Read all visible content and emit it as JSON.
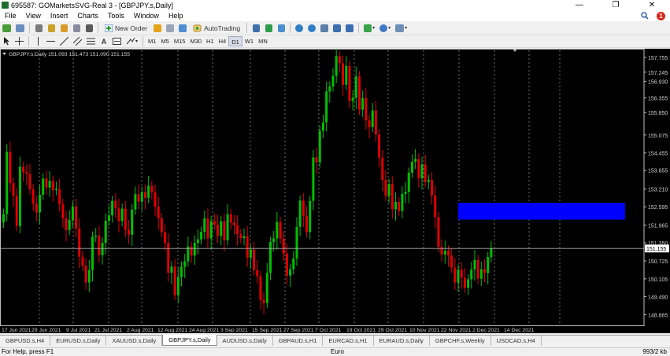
{
  "window": {
    "title": "695587: GOMarketsSVG-Real 3 - [GBPJPY.s,Daily]",
    "minimize_glyph": "—",
    "restore_glyph": "❐",
    "close_glyph": "✕"
  },
  "menu": {
    "items": [
      "File",
      "View",
      "Insert",
      "Charts",
      "Tools",
      "Window",
      "Help"
    ],
    "notification_count": "1"
  },
  "toolbar": {
    "new_order_label": "New Order",
    "autotrading_label": "AutoTrading"
  },
  "timeframes": [
    "M1",
    "M5",
    "M15",
    "M30",
    "H1",
    "H4",
    "D1",
    "W1",
    "MN"
  ],
  "active_timeframe": "D1",
  "chart": {
    "header": "GBPJPY.s,Daily  151.093 151.473 151.090 151.155",
    "current_price_label": "151.155"
  },
  "chart_data": {
    "type": "candlestick",
    "symbol": "GBPJPY.s",
    "timeframe": "Daily",
    "y_range": [
      148.5,
      158.0
    ],
    "y_ticks": [
      "157.755",
      "157.245",
      "156.930",
      "156.355",
      "155.850",
      "155.075",
      "154.455",
      "153.855",
      "153.210",
      "152.595",
      "151.965",
      "151.350",
      "150.725",
      "150.105",
      "149.490",
      "148.865"
    ],
    "x_labels": [
      "17 Jun 2021",
      "29 Jun 2021",
      "9 Jul 2021",
      "21 Jul 2021",
      "2 Aug 2021",
      "12 Aug 2021",
      "24 Aug 2021",
      "3 Sep 2021",
      "15 Sep 2021",
      "27 Sep 2021",
      "7 Oct 2021",
      "19 Oct 2021",
      "29 Oct 2021",
      "10 Nov 2021",
      "22 Nov 2021",
      "2 Dec 2021",
      "14 Dec 2021"
    ],
    "last_price": 151.155,
    "zone_rectangle": {
      "price_high": 152.73,
      "price_low": 152.15,
      "color": "#0000ff"
    },
    "up_color": "#00c000",
    "down_color": "#e00000",
    "closes": [
      152.35,
      154.5,
      153.41,
      152.98,
      151.93,
      153.98,
      153.79,
      153.73,
      153.2,
      152.7,
      152.4,
      153.01,
      153.57,
      153.26,
      153.49,
      153.17,
      153.21,
      152.68,
      152.2,
      151.79,
      152.14,
      152.61,
      151.85,
      150.87,
      150.56,
      149.98,
      150.41,
      151.56,
      151.6,
      150.92,
      151.35,
      152.11,
      152.3,
      152.8,
      152.54,
      152.1,
      152.53,
      151.8,
      151.63,
      152.5,
      153.03,
      152.77,
      153.11,
      152.9,
      153.32,
      153.1,
      152.6,
      152.2,
      151.72,
      151.34,
      150.32,
      150.53,
      149.54,
      150.17,
      150.52,
      150.71,
      151.22,
      150.91,
      151.35,
      151.47,
      151.73,
      152.2,
      151.5,
      152.1,
      151.98,
      151.59,
      152.1,
      151.44,
      152.34,
      152.05,
      151.96,
      151.65,
      151.51,
      151.58,
      150.84,
      151.12,
      150.41,
      150.2,
      149.38,
      149.27,
      150.31,
      151.38,
      151.5,
      152.07,
      151.5,
      150.98,
      150.22,
      150.44,
      150.81,
      151.9,
      152.81,
      152.28,
      151.72,
      152.8,
      154.3,
      154.13,
      155.22,
      155.51,
      156.58,
      156.75,
      157.12,
      157.8,
      157.55,
      156.81,
      157.46,
      156.25,
      156.36,
      157.1,
      155.95,
      156.35,
      155.58,
      155.35,
      155.92,
      155.09,
      154.29,
      153.52,
      152.98,
      153.38,
      152.51,
      152.76,
      152.45,
      153.04,
      153.11,
      153.77,
      154.15,
      154.25,
      153.58,
      154.05,
      153.45,
      153.52,
      152.99,
      152.24,
      151.21,
      150.95,
      151.08,
      150.91,
      150.49,
      149.98,
      150.43,
      150.14,
      149.8,
      150.09,
      150.43,
      150.76,
      150.11,
      150.44,
      150.31,
      150.86,
      151.15
    ]
  },
  "tabs": [
    "GBPUSD.s,H4",
    "EURUSD.s,Daily",
    "XAUUSD.s,Daily",
    "GBPJPY.s,Daily",
    "AUDUSD.s,Daily",
    "GBPAUD.s,H1",
    "EURCAD.s,H1",
    "EURAUD.s,Daily",
    "GBPCHF.s,Weekly",
    "USDCAD.s,H4"
  ],
  "active_tab": "GBPJPY.s,Daily",
  "status": {
    "help": "For Help, press F1",
    "profile": "Euro",
    "traffic": "993/2 kb"
  }
}
